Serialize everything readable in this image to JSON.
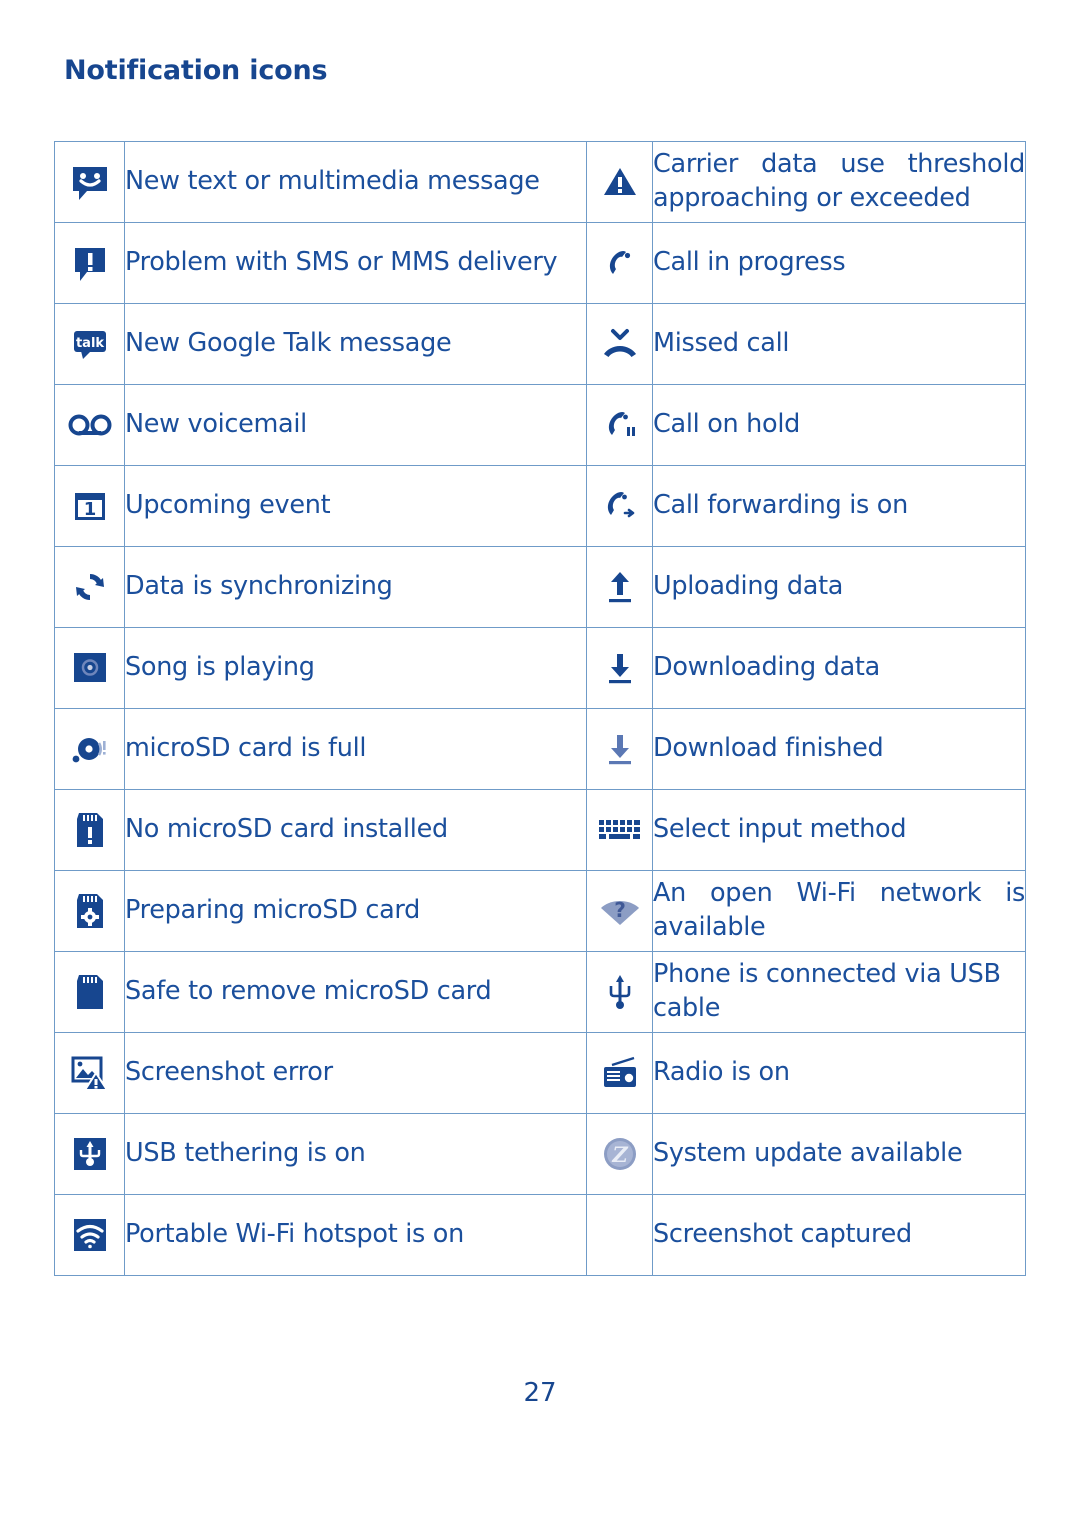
{
  "document": {
    "heading": "Notification icons",
    "page_number": "27",
    "accent_color": "#17468f",
    "text_color": "#1b4f9c",
    "border_color": "#6f9bc8",
    "muted_icon_color": "#8c9dc4"
  },
  "table": {
    "rows": [
      {
        "left": {
          "icon": "message-smiley-icon",
          "label": "New text or multimedia message"
        },
        "right": {
          "icon": "warning-triangle-icon",
          "label": "Carrier data use threshold approaching or exceeded",
          "justified": true
        }
      },
      {
        "left": {
          "icon": "message-error-icon",
          "label": "Problem with SMS or MMS delivery"
        },
        "right": {
          "icon": "phone-handset-icon",
          "label": "Call in progress"
        }
      },
      {
        "left": {
          "icon": "google-talk-icon",
          "label": "New Google Talk message"
        },
        "right": {
          "icon": "missed-call-icon",
          "label": "Missed call"
        }
      },
      {
        "left": {
          "icon": "voicemail-icon",
          "label": "New voicemail"
        },
        "right": {
          "icon": "call-on-hold-icon",
          "label": "Call on hold"
        }
      },
      {
        "left": {
          "icon": "calendar-event-icon",
          "label": "Upcoming event"
        },
        "right": {
          "icon": "call-forwarding-icon",
          "label": "Call forwarding is on"
        }
      },
      {
        "left": {
          "icon": "sync-icon",
          "label": "Data is synchronizing"
        },
        "right": {
          "icon": "upload-arrow-icon",
          "label": "Uploading data"
        }
      },
      {
        "left": {
          "icon": "music-disc-icon",
          "label": "Song is playing"
        },
        "right": {
          "icon": "download-arrow-icon",
          "label": "Downloading data"
        }
      },
      {
        "left": {
          "icon": "sd-card-full-icon",
          "label": "microSD card is full"
        },
        "right": {
          "icon": "download-finished-icon",
          "label": "Download finished"
        }
      },
      {
        "left": {
          "icon": "sd-card-missing-icon",
          "label": "No microSD card installed"
        },
        "right": {
          "icon": "keyboard-icon",
          "label": "Select input method"
        }
      },
      {
        "left": {
          "icon": "sd-card-preparing-icon",
          "label": "Preparing microSD card"
        },
        "right": {
          "icon": "wifi-question-icon",
          "label": "An open Wi-Fi network is available",
          "justified": true
        }
      },
      {
        "left": {
          "icon": "sd-card-safe-remove-icon",
          "label": "Safe to remove microSD card"
        },
        "right": {
          "icon": "usb-icon",
          "label": "Phone is connected via USB cable"
        }
      },
      {
        "left": {
          "icon": "screenshot-error-icon",
          "label": "Screenshot error"
        },
        "right": {
          "icon": "radio-icon",
          "label": "Radio is on"
        }
      },
      {
        "left": {
          "icon": "usb-tethering-icon",
          "label": "USB tethering is on"
        },
        "right": {
          "icon": "system-update-icon",
          "label": "System update available"
        }
      },
      {
        "left": {
          "icon": "wifi-hotspot-icon",
          "label": "Portable Wi-Fi hotspot is on"
        },
        "right": {
          "icon": "",
          "label": "Screenshot captured"
        }
      }
    ]
  }
}
